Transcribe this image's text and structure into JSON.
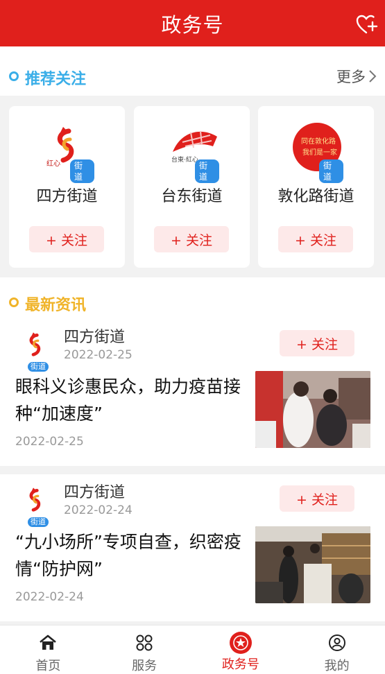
{
  "header": {
    "title": "政务号",
    "fav_icon": "heart-plus-icon"
  },
  "recommend": {
    "title": "推荐关注",
    "more_label": "更多",
    "accent": "#3aaee8",
    "cards": [
      {
        "name": "四方街道",
        "badge": "街道",
        "follow_label": "+ 关注"
      },
      {
        "name": "台东街道",
        "badge": "街道",
        "follow_label": "+ 关注"
      },
      {
        "name": "敦化路街道",
        "badge": "街道",
        "follow_label": "+ 关注",
        "logo_text_1": "同在敦化路",
        "logo_text_2": "我们是一家"
      }
    ]
  },
  "news": {
    "title": "最新资讯",
    "accent": "#f0b42a",
    "items": [
      {
        "source": "四方街道",
        "source_date": "2022-02-25",
        "badge": "街道",
        "follow_label": "+ 关注",
        "headline": "眼科义诊惠民众，助力疫苗接种“加速度”",
        "date": "2022-02-25"
      },
      {
        "source": "四方街道",
        "source_date": "2022-02-24",
        "badge": "街道",
        "follow_label": "+ 关注",
        "headline": "“九小场所”专项自查，织密疫情“防护网”",
        "date": "2022-02-24"
      }
    ]
  },
  "tabs": [
    {
      "label": "首页",
      "icon": "home-icon"
    },
    {
      "label": "服务",
      "icon": "grid-icon"
    },
    {
      "label": "政务号",
      "icon": "emblem-icon",
      "active": true
    },
    {
      "label": "我的",
      "icon": "user-icon"
    }
  ],
  "colors": {
    "brand_red": "#e0201c",
    "badge_blue": "#2f8fe5",
    "follow_bg": "#fde9e9"
  }
}
